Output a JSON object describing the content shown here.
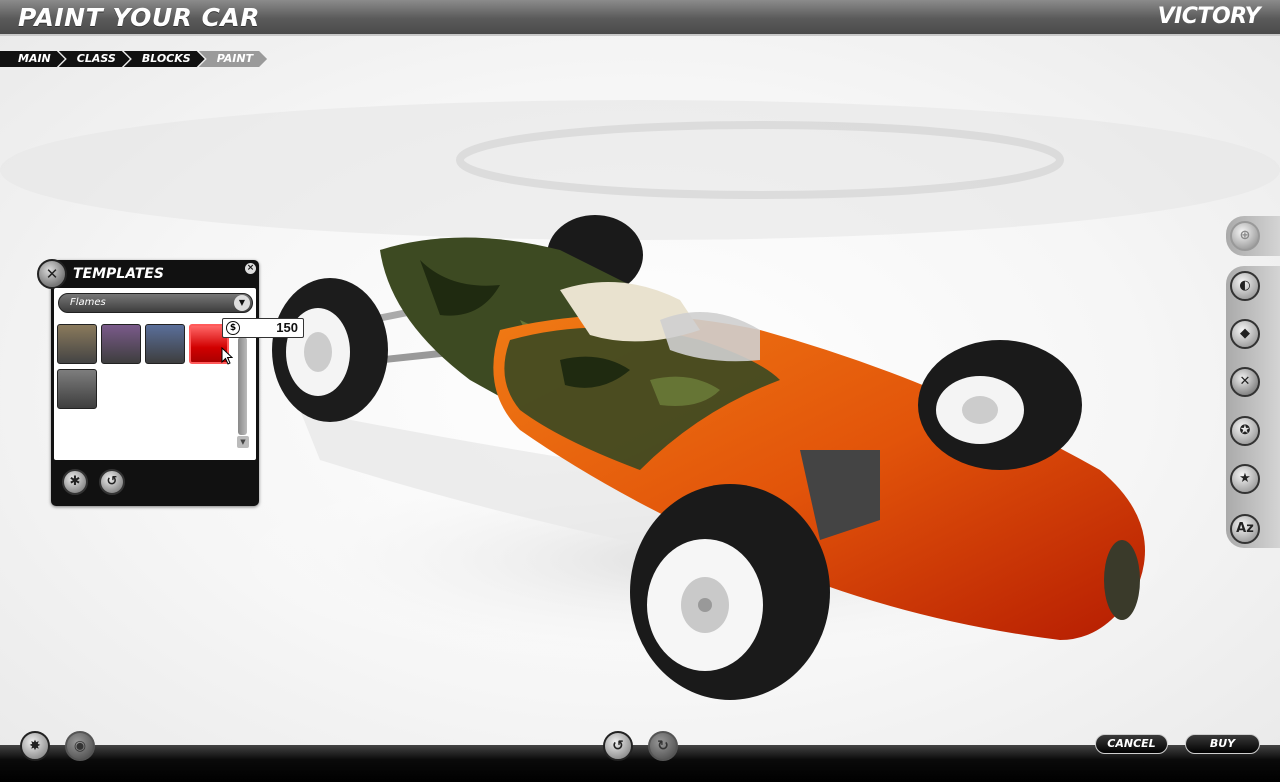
{
  "header": {
    "title": "PAINT YOUR CAR",
    "brand": "VICTORY"
  },
  "breadcrumb": [
    "MAIN",
    "CLASS",
    "BLOCKS",
    "PAINT"
  ],
  "templates_panel": {
    "title": "TEMPLATES",
    "close_glyph": "×",
    "category": "Flames",
    "swatch_count": 5,
    "selected_swatch": 4,
    "price_symbol": "$",
    "price": "150"
  },
  "side_toolbar": [
    "shop-cart-icon",
    "paint-bucket-icon",
    "blocks-icon",
    "templates-icon",
    "decals-icon",
    "star-icon",
    "text-icon"
  ],
  "side_text_glyph": "Az",
  "bottom": {
    "cancel_label": "CANCEL",
    "buy_label": "BUY"
  },
  "colors": {
    "header_gray": "#5a5a5a",
    "body_orange": "#e2540a",
    "camo_green": "#3d4a22",
    "selected_red": "#d10000"
  }
}
